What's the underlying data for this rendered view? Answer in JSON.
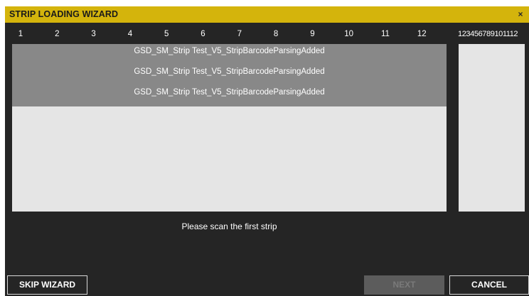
{
  "window": {
    "title": "STRIP LOADING WIZARD",
    "close_glyph": "×",
    "title_bar_color": "#d4b40c",
    "background_color": "#252525"
  },
  "grid": {
    "columns": [
      "1",
      "2",
      "3",
      "4",
      "5",
      "6",
      "7",
      "8",
      "9",
      "10",
      "11",
      "12"
    ],
    "side_header": "123456789101112",
    "strips": [
      "GSD_SM_Strip Test_V5_StripBarcodeParsingAdded",
      "GSD_SM_Strip Test_V5_StripBarcodeParsingAdded",
      "GSD_SM_Strip Test_V5_StripBarcodeParsingAdded"
    ]
  },
  "status": {
    "message": "Please scan the first strip"
  },
  "buttons": {
    "skip_label": "SKIP WIZARD",
    "next_label": "NEXT",
    "cancel_label": "CANCEL"
  },
  "icons": {
    "close": "close-icon"
  }
}
